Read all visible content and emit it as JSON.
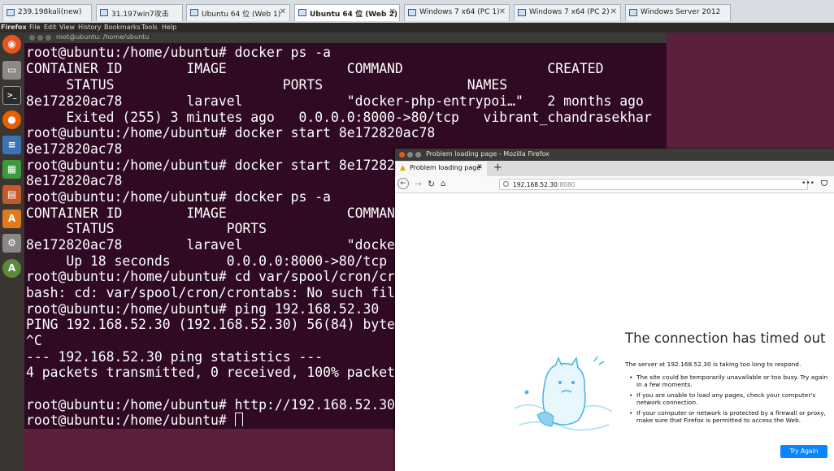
{
  "vm_tabs": [
    {
      "label": "239.198kali(new)"
    },
    {
      "label": "31.197win7攻击"
    },
    {
      "label": "Ubuntu 64 位 (Web 1)"
    },
    {
      "label": "Ubuntu 64 位 (Web 2)"
    },
    {
      "label": "Windows 7 x64 (PC 1)"
    },
    {
      "label": "Windows 7 x64 (PC 2)"
    },
    {
      "label": "Windows Server 2012"
    }
  ],
  "top_panel": {
    "app_name": "Firefox",
    "menu": [
      "File",
      "Edit",
      "View",
      "History",
      "Bookmarks",
      "Tools",
      "Help"
    ]
  },
  "terminal": {
    "title": "root@ubuntu: /home/ubuntu",
    "lines": [
      "root@ubuntu:/home/ubuntu# docker ps -a",
      "CONTAINER ID        IMAGE               COMMAND                  CREATED",
      "     STATUS                     PORTS                  NAMES",
      "8e172820ac78        laravel             \"docker-php-entrypoi…\"   2 months ago",
      "     Exited (255) 3 minutes ago   0.0.0.0:8000->80/tcp   vibrant_chandrasekhar",
      "root@ubuntu:/home/ubuntu# docker start 8e172820ac78",
      "8e172820ac78",
      "root@ubuntu:/home/ubuntu# docker start 8e172820",
      "8e172820ac78",
      "root@ubuntu:/home/ubuntu# docker ps -a",
      "CONTAINER ID        IMAGE               COMMAND",
      "     STATUS              PORTS",
      "8e172820ac78        laravel             \"docke",
      "     Up 18 seconds       0.0.0.0:8000->80/tcp",
      "root@ubuntu:/home/ubuntu# cd var/spool/cron/cr",
      "bash: cd: var/spool/cron/crontabs: No such fil",
      "root@ubuntu:/home/ubuntu# ping 192.168.52.30",
      "PING 192.168.52.30 (192.168.52.30) 56(84) bytes",
      "^C",
      "--- 192.168.52.30 ping statistics ---",
      "4 packets transmitted, 0 received, 100% packet",
      "",
      "root@ubuntu:/home/ubuntu# http://192.168.52.30",
      "root@ubuntu:/home/ubuntu# "
    ]
  },
  "firefox": {
    "window_title": "Problem loading page - Mozilla Firefox",
    "tab_label": "Problem loading page",
    "url_host": "192.168.52.30",
    "url_port": ":8080",
    "error_title": "The connection has timed out",
    "error_text": "The server at 192.168.52.30 is taking too long to respond.",
    "bullets": [
      "The site could be temporarily unavailable or too busy. Try again in a few moments.",
      "If you are unable to load any pages, check your computer's network connection.",
      "If your computer or network is protected by a firewall or proxy, make sure that Firefox is permitted to access the Web."
    ],
    "try_again": "Try Again"
  },
  "colors": {
    "terminal_bg": "#300a24",
    "desktop_bg": "#5c1f3c",
    "launcher_bg": "#3c3633",
    "firefox_button": "#0a84ff"
  }
}
